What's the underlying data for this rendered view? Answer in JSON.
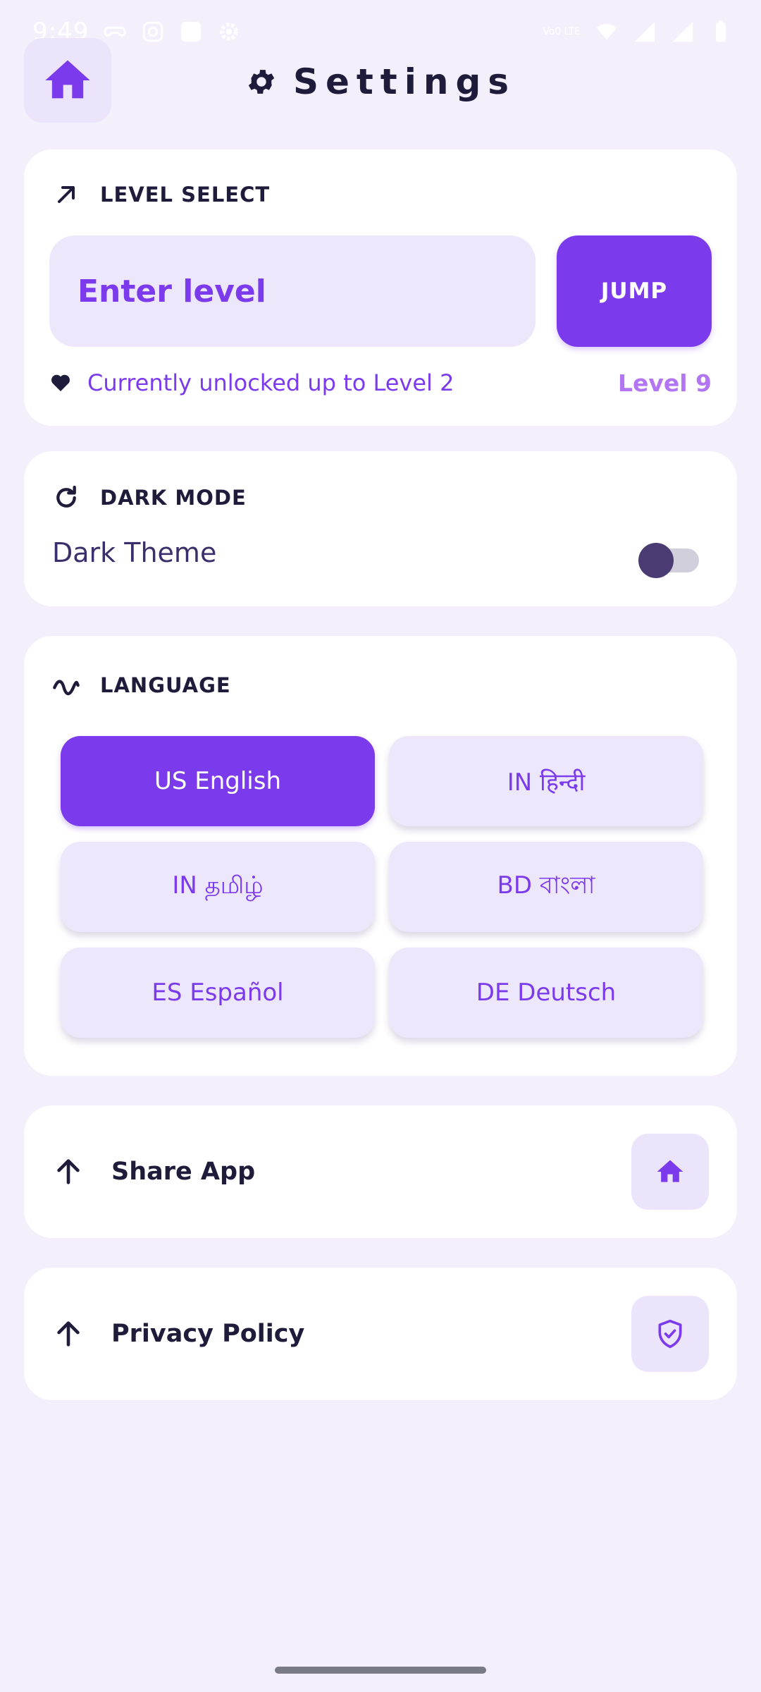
{
  "status_bar": {
    "time": "9:49",
    "network": "Vo0 LTE"
  },
  "header": {
    "title": "Settings"
  },
  "level_select": {
    "heading": "LEVEL SELECT",
    "input_placeholder": "Enter level",
    "jump_label": "JUMP",
    "unlocked_text": "Currently unlocked up to Level 2",
    "max_level": "Level 9"
  },
  "dark_mode": {
    "heading": "DARK MODE",
    "label": "Dark Theme",
    "enabled": false
  },
  "language": {
    "heading": "LANGUAGE",
    "options": [
      {
        "label": "US English",
        "active": true
      },
      {
        "label": "IN हिन्दी",
        "active": false
      },
      {
        "label": "IN தமிழ்",
        "active": false
      },
      {
        "label": "BD বাংলা",
        "active": false
      },
      {
        "label": "ES Español",
        "active": false
      },
      {
        "label": "DE Deutsch",
        "active": false
      }
    ]
  },
  "share": {
    "label": "Share App",
    "icon": "home-icon"
  },
  "privacy": {
    "label": "Privacy Policy",
    "icon": "shield-check-icon"
  },
  "colors": {
    "accent": "#7c3aed",
    "accent_light": "#ede7fb",
    "background": "#f3f0fc",
    "text_dark": "#1f1b3a"
  }
}
